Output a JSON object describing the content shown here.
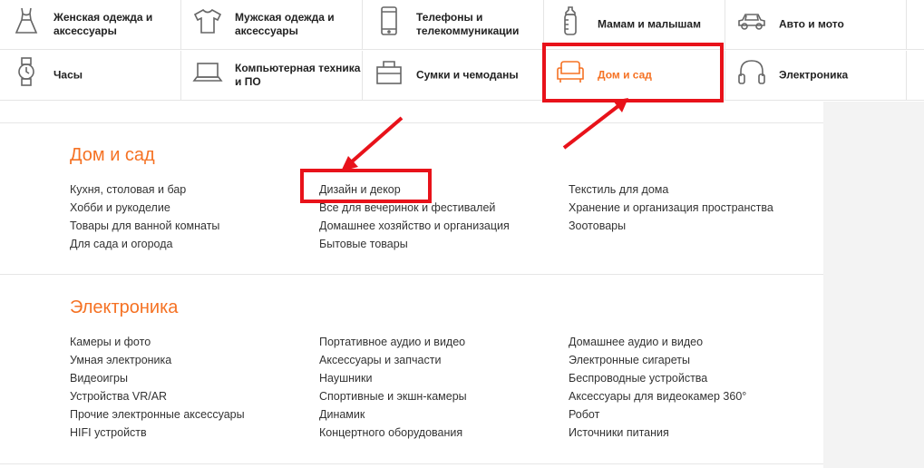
{
  "categories": [
    {
      "label": "Женская одежда и аксессуары",
      "icon": "dress-icon"
    },
    {
      "label": "Мужская одежда и аксессуары",
      "icon": "tshirt-icon"
    },
    {
      "label": "Телефоны и телекоммуникации",
      "icon": "phone-icon"
    },
    {
      "label": "Мамам и малышам",
      "icon": "baby-bottle-icon"
    },
    {
      "label": "Авто и мото",
      "icon": "car-icon"
    },
    {
      "label": "Часы",
      "icon": "watch-icon"
    },
    {
      "label": "Компьютерная техника и ПО",
      "icon": "laptop-icon"
    },
    {
      "label": "Сумки и чемоданы",
      "icon": "bag-icon"
    },
    {
      "label": "Дом и сад",
      "icon": "sofa-icon",
      "active": true
    },
    {
      "label": "Электроника",
      "icon": "headphones-icon"
    }
  ],
  "sections": [
    {
      "title": "Дом и сад",
      "col1": [
        "Кухня, столовая и бар",
        "Хобби и рукоделие",
        "Товары для ванной комнаты",
        "Для сада и огорода"
      ],
      "col2": [
        "Дизайн и декор",
        "Все для вечеринок и фестивалей",
        "Домашнее хозяйство и организация",
        "Бытовые товары"
      ],
      "col3": [
        "Текстиль для дома",
        "Хранение и организация пространства",
        "Зоотовары"
      ]
    },
    {
      "title": "Электроника",
      "col1": [
        "Камеры и фото",
        "Умная электроника",
        "Видеоигры",
        "Устройства VR/AR",
        "Прочие электронные аксессуары",
        "HIFI устройств"
      ],
      "col2": [
        "Портативное аудио и видео",
        "Аксессуары и запчасти",
        "Наушники",
        "Спортивные и экшн-камеры",
        "Динамик",
        "Концертного оборудования"
      ],
      "col3": [
        "Домашнее аудио и видео",
        "Электронные сигареты",
        "Беспроводные устройства",
        "Аксессуары для видеокамер 360°",
        "Робот",
        "Источники питания"
      ]
    }
  ],
  "colors": {
    "accent": "#f57224",
    "annotation": "#e8121a"
  }
}
